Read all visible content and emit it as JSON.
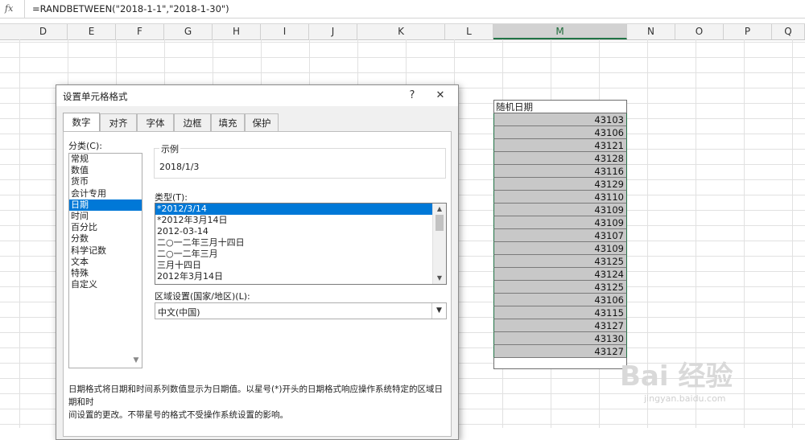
{
  "formula_bar": {
    "fx_label": "fx",
    "formula": "=RANDBETWEEN(\"2018-1-1\",\"2018-1-30\")"
  },
  "columns": [
    "D",
    "E",
    "F",
    "G",
    "H",
    "I",
    "J",
    "K",
    "L",
    "M",
    "N",
    "O",
    "P",
    "Q"
  ],
  "selected_column": "M",
  "column_m": {
    "header": "随机日期",
    "values": [
      "43103",
      "43106",
      "43121",
      "43128",
      "43116",
      "43129",
      "43110",
      "43109",
      "43109",
      "43107",
      "43109",
      "43125",
      "43124",
      "43125",
      "43106",
      "43115",
      "43127",
      "43130",
      "43127"
    ]
  },
  "dialog": {
    "title": "设置单元格格式",
    "help": "?",
    "close": "✕",
    "tabs": [
      "数字",
      "对齐",
      "字体",
      "边框",
      "填充",
      "保护"
    ],
    "active_tab": "数字",
    "category_label": "分类(C):",
    "categories": [
      "常规",
      "数值",
      "货币",
      "会计专用",
      "日期",
      "时间",
      "百分比",
      "分数",
      "科学记数",
      "文本",
      "特殊",
      "自定义"
    ],
    "selected_category": "日期",
    "sample_label": "示例",
    "sample_value": "2018/1/3",
    "type_label": "类型(T):",
    "types": [
      "*2012/3/14",
      "*2012年3月14日",
      "2012-03-14",
      "二○一二年三月十四日",
      "二○一二年三月",
      "三月十四日",
      "2012年3月14日"
    ],
    "selected_type": "*2012/3/14",
    "locale_label": "区域设置(国家/地区)(L):",
    "locale_value": "中文(中国)",
    "description_line1": "日期格式将日期和时间系列数值显示为日期值。以星号(*)开头的日期格式响应操作系统特定的区域日期和时",
    "description_line2": "间设置的更改。不带星号的格式不受操作系统设置的影响。"
  },
  "watermark": {
    "main": "Bai 经验",
    "sub": "jingyan.baidu.com"
  }
}
